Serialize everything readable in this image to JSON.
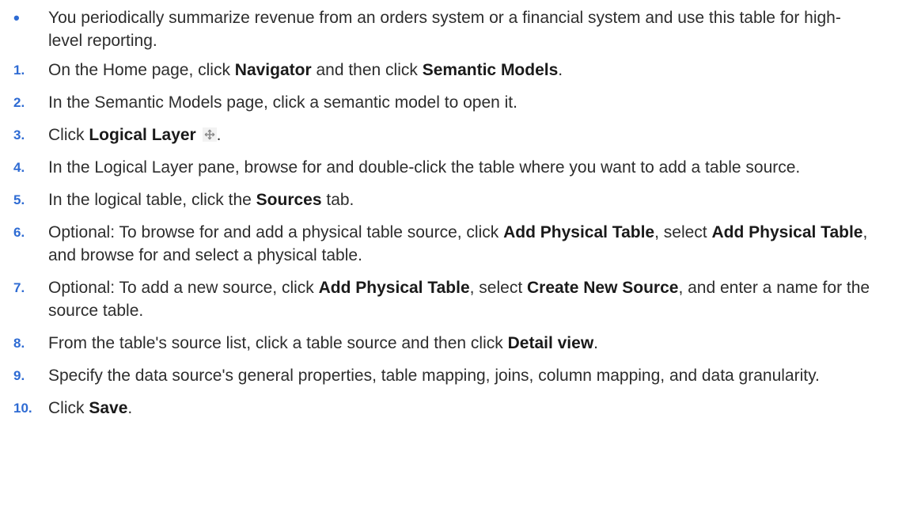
{
  "intro_bullet": {
    "marker": "•",
    "text": "You periodically summarize revenue from an orders system or a financial system and use this table for high-level reporting."
  },
  "steps": [
    {
      "num": "1.",
      "t1": "On the Home page, click ",
      "b1": "Navigator",
      "t2": " and then click ",
      "b2": "Semantic Models",
      "t3": "."
    },
    {
      "num": "2.",
      "t1": "In the Semantic Models page, click a semantic model to open it."
    },
    {
      "num": "3.",
      "t1": "Click ",
      "b1": "Logical Layer",
      "icon": "logical-layer-icon",
      "t2": "."
    },
    {
      "num": "4.",
      "t1": "In the Logical Layer pane, browse for and double-click the table where you want to add a table source."
    },
    {
      "num": "5.",
      "t1": "In the logical table, click the ",
      "b1": "Sources",
      "t2": " tab."
    },
    {
      "num": "6.",
      "t1": "Optional: To browse for and add a physical table source, click ",
      "b1": "Add Physical Table",
      "t2": ", select ",
      "b2": "Add Physical Table",
      "t3": ", and browse for and select a physical table."
    },
    {
      "num": "7.",
      "t1": "Optional: To add a new source, click ",
      "b1": "Add Physical Table",
      "t2": ", select ",
      "b2": "Create New Source",
      "t3": ", and enter a name for the source table."
    },
    {
      "num": "8.",
      "t1": "From the table's source list, click a table source and then click ",
      "b1": "Detail view",
      "t2": "."
    },
    {
      "num": "9.",
      "t1": "Specify the data source's general properties, table mapping, joins, column mapping, and data granularity."
    },
    {
      "num": "10.",
      "t1": "Click ",
      "b1": "Save",
      "t2": "."
    }
  ],
  "colors": {
    "marker": "#2e6bd3",
    "text": "#2d2d2d"
  }
}
